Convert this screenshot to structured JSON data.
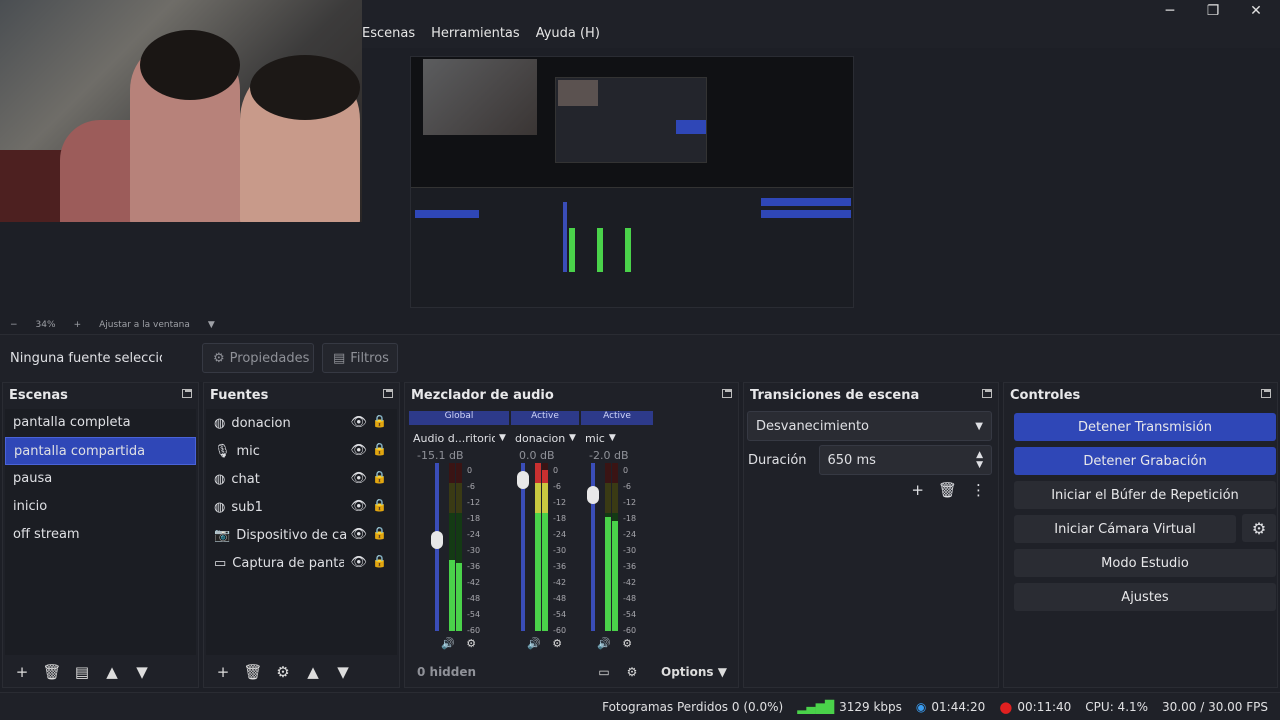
{
  "menu": [
    "Escenas",
    "Herramientas",
    "Ayuda (H)"
  ],
  "window": {
    "minimize": "─",
    "maximize": "❐",
    "close": "✕"
  },
  "zoom": {
    "minus": "−",
    "percent": "34%",
    "plus": "+",
    "fit": "Ajustar a la ventana"
  },
  "props": {
    "selection": "Ninguna fuente seleccionada",
    "properties": "Propiedades",
    "filters": "Filtros"
  },
  "scenes": {
    "title": "Escenas",
    "items": [
      "pantalla completa",
      "pantalla compartida",
      "pausa",
      "inicio",
      "off stream"
    ],
    "selected": "pantalla compartida"
  },
  "sources": {
    "title": "Fuentes",
    "items": [
      {
        "label": "donacion",
        "icon": "globe-icon"
      },
      {
        "label": "mic",
        "icon": "microphone-icon"
      },
      {
        "label": "chat",
        "icon": "globe-icon"
      },
      {
        "label": "sub1",
        "icon": "globe-icon"
      },
      {
        "label": "Dispositivo de captura de video",
        "icon": "camera-icon"
      },
      {
        "label": "Captura de pantalla",
        "icon": "monitor-icon"
      }
    ]
  },
  "mixer": {
    "title": "Mezclador de audio",
    "channels": [
      {
        "header": "Global",
        "name": "Audio d...ritorio",
        "db": "-15.1 dB",
        "level": 0.42,
        "fader": 0.55
      },
      {
        "header": "Active",
        "name": "donacion",
        "db": "0.0 dB",
        "level": 1.0,
        "fader": 0.95
      },
      {
        "header": "Active",
        "name": "mic",
        "db": "-2.0 dB",
        "level": 0.68,
        "fader": 0.85
      }
    ],
    "ticks": [
      "0",
      "-6",
      "-12",
      "-18",
      "-24",
      "-30",
      "-36",
      "-42",
      "-48",
      "-54",
      "-60"
    ],
    "hidden": "0 hidden",
    "options": "Options"
  },
  "transitions": {
    "title": "Transiciones de escena",
    "selected": "Desvanecimiento",
    "duration_label": "Duración",
    "duration": "650 ms"
  },
  "controls": {
    "title": "Controles",
    "buttons": [
      {
        "label": "Detener Transmisión",
        "active": true
      },
      {
        "label": "Detener Grabación",
        "active": true
      },
      {
        "label": "Iniciar el Búfer de Repetición",
        "active": false
      },
      {
        "label": "Iniciar Cámara Virtual",
        "active": false
      },
      {
        "label": "Modo Estudio",
        "active": false
      },
      {
        "label": "Ajustes",
        "active": false
      }
    ]
  },
  "status": {
    "dropped": "Fotogramas Perdidos 0 (0.0%)",
    "bitrate": "3129 kbps",
    "stream_time": "01:44:20",
    "rec_time": "00:11:40",
    "cpu": "CPU: 4.1%",
    "fps": "30.00 / 30.00 FPS"
  },
  "colors": {
    "accent": "#2f47b7",
    "meter_green": "#4ad24a",
    "meter_yellow": "#c8c840",
    "meter_red": "#c83030",
    "rec": "#e02020",
    "stream": "#3a9cf0"
  }
}
